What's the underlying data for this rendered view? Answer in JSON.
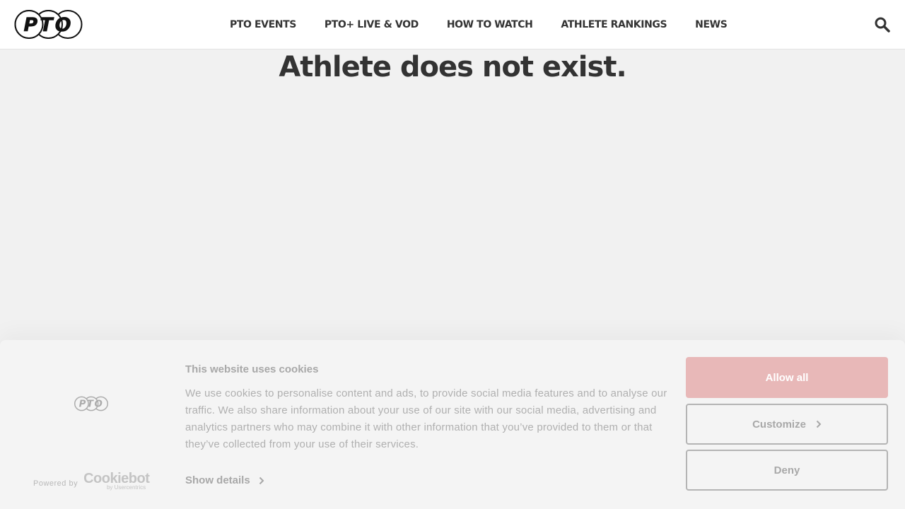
{
  "header": {
    "logo_text": "PTO",
    "nav": [
      {
        "label": "PTO EVENTS"
      },
      {
        "label": "PTO+ LIVE & VOD"
      },
      {
        "label": "HOW TO WATCH"
      },
      {
        "label": "ATHLETE RANKINGS"
      },
      {
        "label": "NEWS"
      }
    ],
    "search_icon": "search-icon"
  },
  "main": {
    "title": "Athlete does not exist."
  },
  "cookie_banner": {
    "logo_text": "PTO",
    "powered_by": "Powered by",
    "brand": "Cookiebot",
    "brand_sub": "by Usercentrics",
    "title": "This website uses cookies",
    "body": "We use cookies to personalise content and ads, to provide social media features and to analyse our traffic. We also share information about your use of our site with our social media, advertising and analytics partners who may combine it with other information that you’ve provided to them or that they’ve collected from your use of their services.",
    "show_details": "Show details",
    "allow_all": "Allow all",
    "customize": "Customize",
    "deny": "Deny"
  },
  "colors": {
    "accent_button": "#e8b8b8",
    "text_dark": "#333333",
    "page_bg": "#f1f1f1"
  }
}
